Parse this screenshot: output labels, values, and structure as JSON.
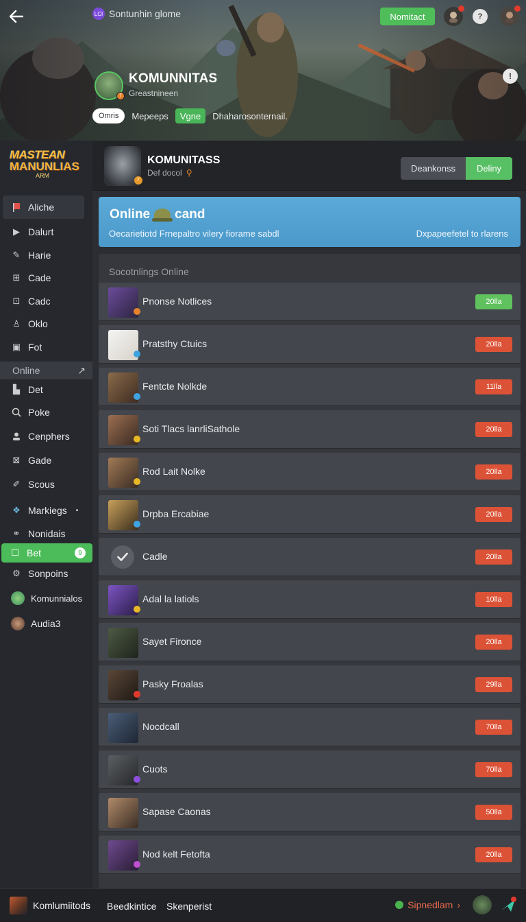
{
  "header": {
    "app_title": "Sontunhin glome",
    "app_logo_text": "LCI",
    "nomitact_label": "Nomitact",
    "profile_name": "KOMUNNITAS",
    "profile_sub": "Greastnineen",
    "chips": [
      "Omris",
      "Mepeeps",
      "Vgne",
      "Dhaharosonternail."
    ],
    "info_label": "!"
  },
  "sidebar": {
    "brand_line1": "MASTEAN",
    "brand_line2": "MANUNLIAS",
    "brand_line3": "ARM",
    "items": [
      {
        "label": "Aliche",
        "icon": "flag-icon"
      },
      {
        "label": "Dalurt",
        "icon": "play-icon"
      },
      {
        "label": "Harie",
        "icon": "wrench-icon"
      },
      {
        "label": "Cade",
        "icon": "gamepad-icon"
      },
      {
        "label": "Cadc",
        "icon": "chart-icon"
      },
      {
        "label": "Oklo",
        "icon": "user-lock-icon"
      },
      {
        "label": "Fot",
        "icon": "doc-icon"
      }
    ],
    "section_label": "Online",
    "items2": [
      {
        "label": "Det",
        "icon": "cup-icon"
      },
      {
        "label": "Poke",
        "icon": "search-icon"
      },
      {
        "label": "Cenphers",
        "icon": "person-icon"
      },
      {
        "label": "Gade",
        "icon": "grid-icon"
      },
      {
        "label": "Scous",
        "icon": "pen-icon"
      },
      {
        "label": "Markiegs",
        "icon": "stack-icon"
      },
      {
        "label": "Nonidais",
        "icon": "link-icon"
      }
    ],
    "active_item": {
      "label": "Bet",
      "icon": "edit-icon",
      "badge": "9"
    },
    "items3": [
      {
        "label": "Sonpoins",
        "icon": "gear-icon"
      },
      {
        "label": "Komunnialos",
        "icon": "group-avatar-icon"
      },
      {
        "label": "Audia3",
        "icon": "user-avatar-icon"
      }
    ]
  },
  "community": {
    "name": "KOMUNITASS",
    "sub": "Def docol",
    "badge": "7",
    "seg_left": "Deankonss",
    "seg_right": "Deliny"
  },
  "banner": {
    "title_a": "Online",
    "title_b": "cand",
    "desc_left": "Oecarietiotd Frnepaltro vilery fiorame sabdl",
    "desc_right": "Dxpapeefetel to rlarens"
  },
  "online": {
    "title": "Socotnlings Online",
    "rows": [
      {
        "name": "Pnonse Notlices",
        "value": "20lla",
        "status": "green"
      },
      {
        "name": "Pratsthy Ctuics",
        "value": "20lla",
        "status": "red"
      },
      {
        "name": "Fentcte Nolkde",
        "value": "11lla",
        "status": "red"
      },
      {
        "name": "Soti Tlacs lanrliSathole",
        "value": "20lla",
        "status": "red"
      },
      {
        "name": "Rod Lait Nolke",
        "value": "20lla",
        "status": "red"
      },
      {
        "name": "Drpba Ercabiae",
        "value": "20lla",
        "status": "red"
      },
      {
        "name": "Cadle",
        "value": "20lla",
        "status": "red"
      },
      {
        "name": "Adal la latiols",
        "value": "10lla",
        "status": "red"
      },
      {
        "name": "Sayet Fironce",
        "value": "20lla",
        "status": "red"
      },
      {
        "name": "Pasky Froalas",
        "value": "29lla",
        "status": "red"
      },
      {
        "name": "Nocdcall",
        "value": "70lla",
        "status": "red"
      },
      {
        "name": "Cuots",
        "value": "70lla",
        "status": "red"
      },
      {
        "name": "Sapase Caonas",
        "value": "50lla",
        "status": "red"
      },
      {
        "name": "Nod kelt Fetofta",
        "value": "20lla",
        "status": "red"
      }
    ]
  },
  "bottombar": {
    "left_label": "Komlumiitods",
    "tab1": "Beedkintice",
    "tab2": "Skenperist",
    "right_label": "Sipnedlam"
  }
}
